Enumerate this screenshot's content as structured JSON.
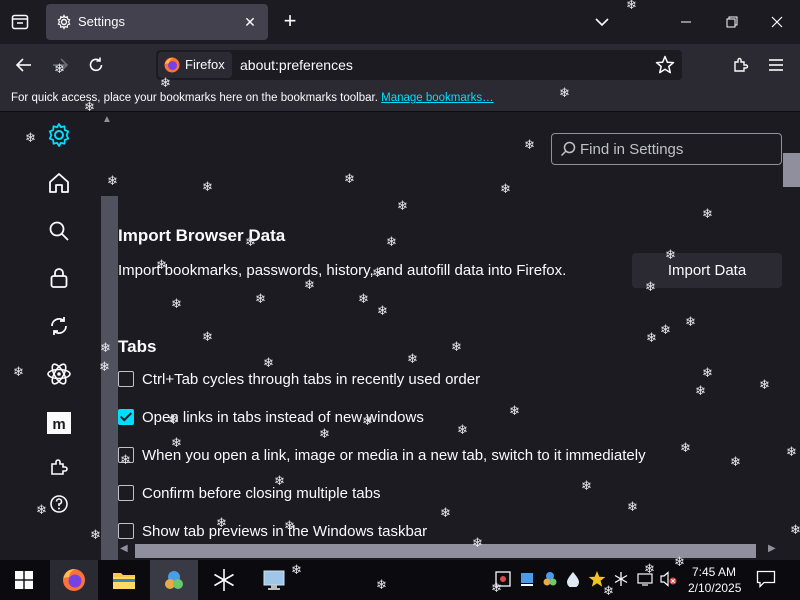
{
  "tab": {
    "title": "Settings"
  },
  "navbar": {
    "identity_label": "Firefox",
    "url": "about:preferences"
  },
  "bookmarks_bar": {
    "hint": "For quick access, place your bookmarks here on the bookmarks toolbar.",
    "manage_link": "Manage bookmarks…"
  },
  "search": {
    "placeholder": "Find in Settings"
  },
  "import_section": {
    "title": "Import Browser Data",
    "description": "Import bookmarks, passwords, history, and autofill data into Firefox.",
    "button": "Import Data"
  },
  "tabs_section": {
    "title": "Tabs",
    "options": [
      {
        "label": "Ctrl+Tab cycles through tabs in recently used order",
        "checked": false
      },
      {
        "label": "Open links in tabs instead of new windows",
        "checked": true
      },
      {
        "label": "When you open a link, image or media in a new tab, switch to it immediately",
        "checked": false
      },
      {
        "label": "Confirm before closing multiple tabs",
        "checked": false
      },
      {
        "label": "Show tab previews in the Windows taskbar",
        "checked": false
      }
    ]
  },
  "sidebar": {
    "items": [
      "gear-icon",
      "home-icon",
      "search-icon",
      "lock-icon",
      "sync-icon",
      "atom-icon",
      "more-from-mozilla-icon",
      "extensions-icon",
      "help-icon"
    ]
  },
  "taskbar": {
    "time": "7:45 AM",
    "date": "2/10/2025"
  },
  "colors": {
    "accent": "#00ddff",
    "background": "#1c1b22",
    "toolbar": "#2b2a33"
  }
}
